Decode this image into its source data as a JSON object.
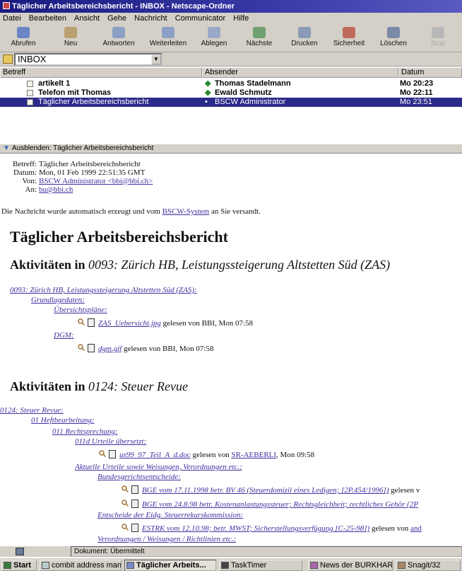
{
  "window": {
    "title": "Täglicher Arbeitsbereichsbericht - INBOX - Netscape-Ordner"
  },
  "menu": [
    "Datei",
    "Bearbeiten",
    "Ansicht",
    "Gehe",
    "Nachricht",
    "Communicator",
    "Hilfe"
  ],
  "toolbar": {
    "buttons": [
      {
        "label": "Abrufen",
        "icon": "get-mail-icon"
      },
      {
        "label": "Neu",
        "icon": "new-msg-icon"
      },
      {
        "label": "Antworten",
        "icon": "reply-icon"
      },
      {
        "label": "Weiterleiten",
        "icon": "forward-icon"
      },
      {
        "label": "Ablegen",
        "icon": "file-icon"
      },
      {
        "label": "Nächste",
        "icon": "next-icon"
      },
      {
        "label": "Drucken",
        "icon": "print-icon"
      },
      {
        "label": "Sicherheit",
        "icon": "security-icon"
      },
      {
        "label": "Löschen",
        "icon": "delete-icon"
      },
      {
        "label": "Stop",
        "icon": "stop-icon"
      }
    ]
  },
  "folder": {
    "selected": "INBOX"
  },
  "columns": {
    "subject": "Betreff",
    "sender": "Absender",
    "date": "Datum"
  },
  "messages": [
    {
      "subject": "artikelt 1",
      "sender": "Thomas Stadelmann",
      "date": "Mo 20:23",
      "selected": false
    },
    {
      "subject": "Telefon mit Thomas",
      "sender": "Ewald Schmutz",
      "date": "Mo 22:11",
      "selected": false
    },
    {
      "subject": "Täglicher Arbeitsbereichsbericht",
      "sender": "BSCW Administrator",
      "date": "Mo 23:51",
      "selected": true
    }
  ],
  "preview": {
    "toggle_label": "Ausblenden: Täglicher Arbeitsbereichsbericht"
  },
  "mail": {
    "headers": {
      "subject_label": "Betreff:",
      "subject": "Täglicher Arbeitsbereichsbericht",
      "date_label": "Datum:",
      "date": "Mon, 01 Feb 1999 22:51:35 GMT",
      "from_label": "Von:",
      "from": "BSCW Administrator <bbi@bbi.ch>",
      "to_label": "An:",
      "to": "bu@bbi.ch"
    },
    "intro_pre": "Die Nachricht wurde automatisch erzeugt und vom ",
    "intro_link": "BSCW-System",
    "intro_post": " an Sie versandt.",
    "title": "Täglicher Arbeitsbereichsbericht",
    "section1_prefix": "Aktivitäten in ",
    "section1_name": "0093: Zürich HB, Leistungssteigerung Altstetten Süd (ZAS)",
    "s1": {
      "root": "0093: Zürich HB, Leistungssteigerung Altstetten Süd (ZAS):",
      "grund": "Grundlagedaten:",
      "ueber": "Übersichtspläne:",
      "file1": "ZAS_Uebersicht.jpg",
      "file1_info": " gelesen von BBI, Mon 07:58",
      "dgm": "DGM:",
      "file2": "dgm.gif",
      "file2_info": " gelesen von BBI, Mon 07:58"
    },
    "section2_prefix": "Aktivitäten in ",
    "section2_name": "0124: Steuer Revue",
    "s2": {
      "root": "0124: Steuer Revue:",
      "heft": "01 Heftbearbeitung:",
      "recht": "011 Rechtsprechung:",
      "urteile": "011d Urteile übersetzt:",
      "file3": "us99_97_Teil_A_d.doc",
      "file3_mid": " gelesen von ",
      "file3_user": "SR-AEBERLI",
      "file3_time": ", Mon 09:58",
      "aktuelle": "Aktuelle Urteile sowie Weisungen, Verordnungen etc.:",
      "bund": "Bundesgerichtsentscheide:",
      "file4": "BGE vom 17.11.1998 betr. BV 46 (Steuerdomizil eines Ledigen; [2P.454/1996])",
      "file4_info": " gelesen v",
      "file5": "BGE vom 24.8.98 betr. Kostenanlastungssteuer; Rechtsgleichheit; rechtliches Gehör (2P",
      "eidg": "Entscheide der Eidg. Steuerrekurskommission:",
      "file6": "ESTRK vom 12.10.98; betr. MWST; Sicherstellungsverfügung [C-25-98])",
      "file6_info": " gelesen von ",
      "file6_user": "and",
      "verord": "Verordnungen / Weisungen / Richtlinien etc.:"
    }
  },
  "status": {
    "text": "Dokument: Übermittelt"
  },
  "taskbar": {
    "start": "Start",
    "items": [
      {
        "label": "combit address man...",
        "active": false
      },
      {
        "label": "Täglicher Arbeits...",
        "active": true
      },
      {
        "label": "TaskTimer",
        "active": false
      },
      {
        "label": "News der BURKHAR...",
        "active": false
      },
      {
        "label": "Snagit/32",
        "active": false
      }
    ]
  },
  "colors": {
    "title_bar": "#1a1a80",
    "selection": "#2a2a8a",
    "link": "#4030a0",
    "chrome": "#d4d0c8"
  }
}
